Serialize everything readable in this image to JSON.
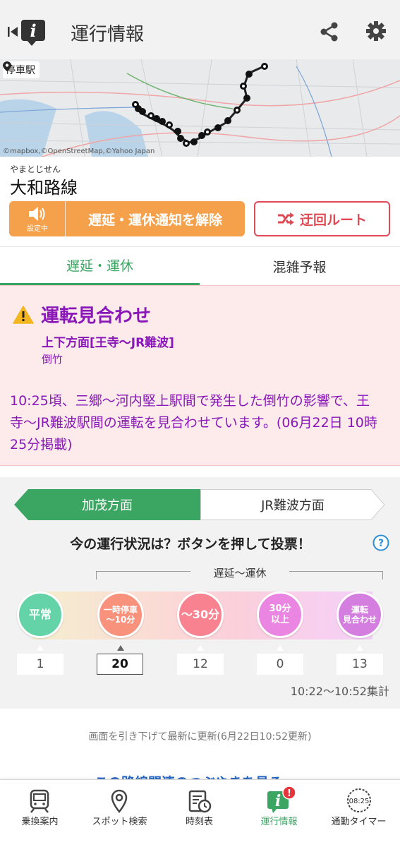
{
  "header": {
    "title": "運行情報"
  },
  "map": {
    "label": "停車駅",
    "credit": "©mapbox,©OpenStreetMap,©Yahoo Japan"
  },
  "line": {
    "furigana": "やまとじせん",
    "name": "大和路線"
  },
  "actions": {
    "unsubscribe_sub": "設定中",
    "unsubscribe_label": "遅延・運休通知を解除",
    "detour_label": "迂回ルート"
  },
  "tabs": [
    {
      "label": "遅延・運休",
      "active": true
    },
    {
      "label": "混雑予報",
      "active": false
    }
  ],
  "alert": {
    "heading": "運転見合わせ",
    "direction": "上下方面[王寺〜JR難波]",
    "cause": "倒竹",
    "description": "10:25頃、三郷〜河内堅上駅間で発生した倒竹の影響で、王寺〜JR難波駅間の運転を見合わせています。(06月22日 10時25分掲載)",
    "color": "#8a18b8"
  },
  "vote": {
    "direction_tabs": [
      {
        "label": "加茂方面",
        "active": true
      },
      {
        "label": "JR難波方面",
        "active": false
      }
    ],
    "question": "今の運行状況は？ボタンを押して投票！",
    "bracket_label": "遅延〜運休",
    "options": [
      {
        "label": "平常",
        "count": "1",
        "color": "#64d4a8"
      },
      {
        "label": "一時停車 〜10分",
        "count": "20",
        "color": "#f9927c",
        "selected": true
      },
      {
        "label": "〜30分",
        "count": "12",
        "color": "#f98290"
      },
      {
        "label": "30分 以上",
        "count": "0",
        "color": "#ea86e2"
      },
      {
        "label": "運転 見合わせ",
        "count": "13",
        "color": "#d47fe0"
      }
    ],
    "period": "10:22〜10:52集計"
  },
  "refresh_note": "画面を引き下げて最新に更新(6月22日10:52更新)",
  "related_link": "この路線関連のつぶやきを見る",
  "bottom_nav": [
    {
      "label": "乗換案内",
      "icon": "train-icon"
    },
    {
      "label": "スポット検索",
      "icon": "map-pin-icon"
    },
    {
      "label": "時刻表",
      "icon": "timetable-icon"
    },
    {
      "label": "運行情報",
      "icon": "info-icon",
      "active": true,
      "badge": "!"
    },
    {
      "label": "通勤タイマー",
      "icon": "timer-icon",
      "timer": "08:25"
    }
  ],
  "accent": "#3ba661"
}
